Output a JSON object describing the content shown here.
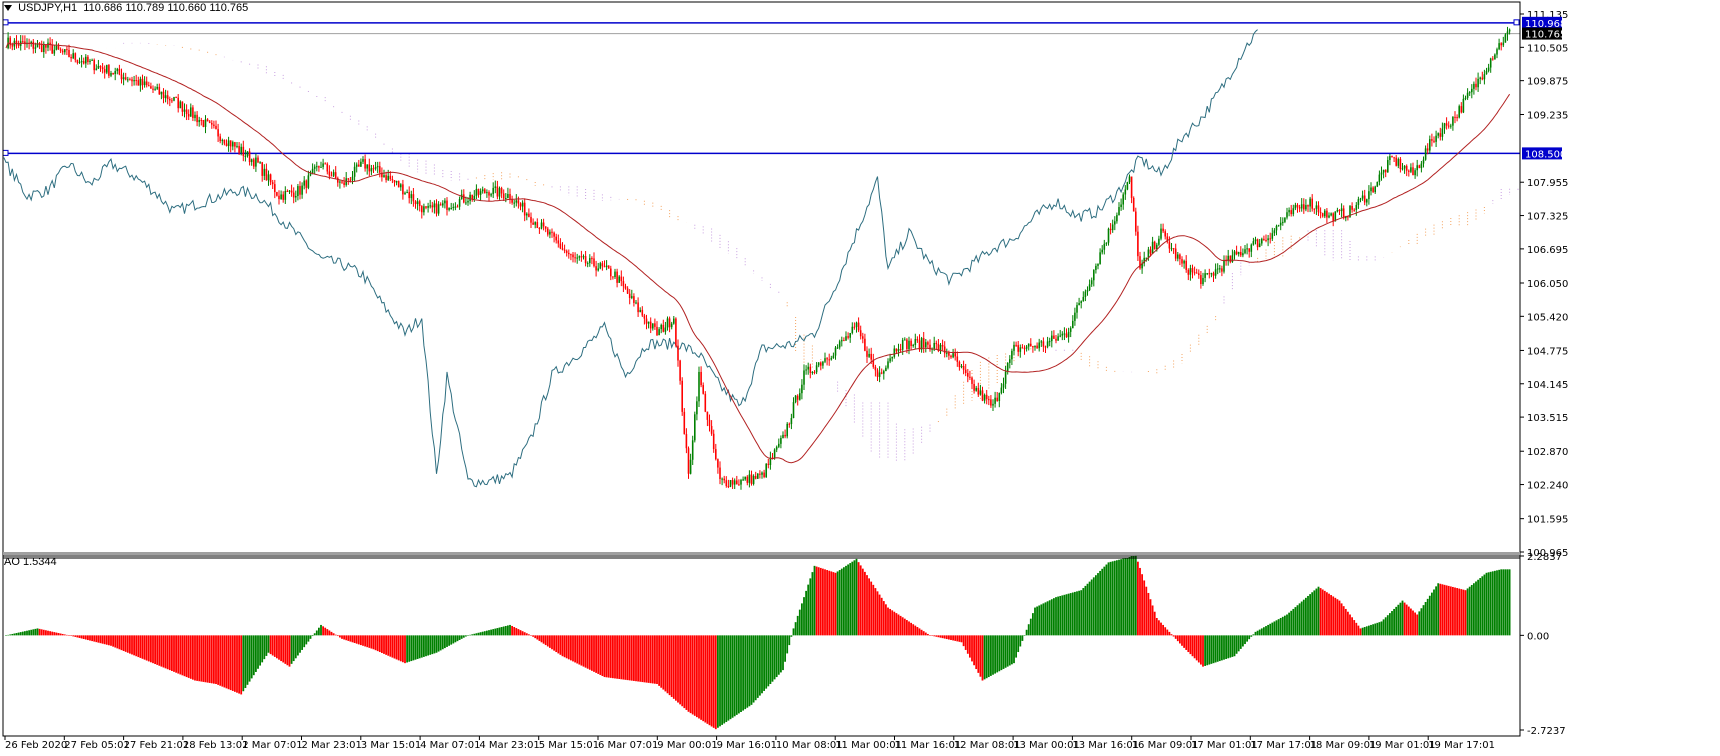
{
  "header": {
    "symbol": "USDJPY,H1",
    "open": "110.686",
    "high": "110.789",
    "low": "110.660",
    "close": "110.765"
  },
  "ao": {
    "label": "AO",
    "value": "1.5344"
  },
  "price_axis": {
    "ticks": [
      "111.135",
      "110.505",
      "109.875",
      "109.235",
      "107.955",
      "107.325",
      "106.695",
      "106.050",
      "105.420",
      "104.775",
      "104.145",
      "103.515",
      "102.870",
      "102.240",
      "101.595",
      "100.965"
    ],
    "tags": [
      {
        "label": "110.968",
        "color": "#0000cc",
        "text_color": "#ffffff"
      },
      {
        "label": "110.765",
        "color": "#000000",
        "text_color": "#ffffff"
      },
      {
        "label": "108.500",
        "color": "#0000cc",
        "text_color": "#ffffff"
      }
    ]
  },
  "ao_axis": {
    "ticks": [
      "2.2837",
      "0.00",
      "-2.7237"
    ]
  },
  "time_axis": {
    "labels": [
      "26 Feb 2020",
      "27 Feb 05:01",
      "27 Feb 21:01",
      "28 Feb 13:01",
      "2 Mar 07:01",
      "2 Mar 23:01",
      "3 Mar 15:01",
      "4 Mar 07:01",
      "4 Mar 23:01",
      "5 Mar 15:01",
      "6 Mar 07:01",
      "9 Mar 00:01",
      "9 Mar 16:01",
      "10 Mar 08:01",
      "11 Mar 00:01",
      "11 Mar 16:01",
      "12 Mar 08:01",
      "13 Mar 00:01",
      "13 Mar 16:01",
      "16 Mar 09:01",
      "17 Mar 01:01",
      "17 Mar 17:01",
      "18 Mar 09:01",
      "19 Mar 01:01",
      "19 Mar 17:01"
    ]
  },
  "colors": {
    "bull": "#008000",
    "bear": "#ff0000",
    "line_blue": "#0000cc",
    "chikou": "#2e6e80",
    "ma": "#b22222",
    "cloud_bull": "#f4a460",
    "cloud_bear": "#c8a0e0"
  },
  "chart_data": {
    "type": "candlestick",
    "symbol": "USDJPY",
    "timeframe": "H1",
    "ylim": [
      100.965,
      111.135
    ],
    "horizontal_levels": [
      110.968,
      108.5
    ],
    "current_price": 110.765,
    "close_path": [
      [
        0,
        110.6
      ],
      [
        20,
        110.5
      ],
      [
        40,
        110.2
      ],
      [
        60,
        109.9
      ],
      [
        80,
        109.5
      ],
      [
        100,
        108.9
      ],
      [
        120,
        108.3
      ],
      [
        130,
        107.7
      ],
      [
        140,
        107.8
      ],
      [
        150,
        108.3
      ],
      [
        160,
        107.9
      ],
      [
        170,
        108.3
      ],
      [
        180,
        108.1
      ],
      [
        190,
        107.8
      ],
      [
        200,
        107.4
      ],
      [
        215,
        107.6
      ],
      [
        230,
        107.8
      ],
      [
        240,
        107.7
      ],
      [
        255,
        107.1
      ],
      [
        270,
        106.5
      ],
      [
        280,
        106.4
      ],
      [
        290,
        106.2
      ],
      [
        300,
        105.6
      ],
      [
        310,
        105.1
      ],
      [
        318,
        105.4
      ],
      [
        325,
        102.4
      ],
      [
        330,
        104.3
      ],
      [
        340,
        102.3
      ],
      [
        350,
        102.3
      ],
      [
        360,
        102.4
      ],
      [
        370,
        103.1
      ],
      [
        380,
        104.3
      ],
      [
        395,
        104.8
      ],
      [
        405,
        105.2
      ],
      [
        415,
        104.3
      ],
      [
        425,
        104.9
      ],
      [
        440,
        104.9
      ],
      [
        450,
        104.7
      ],
      [
        460,
        104.1
      ],
      [
        470,
        103.7
      ],
      [
        480,
        104.8
      ],
      [
        495,
        104.9
      ],
      [
        505,
        105.1
      ],
      [
        515,
        106.0
      ],
      [
        525,
        107.0
      ],
      [
        535,
        108.0
      ],
      [
        540,
        106.3
      ],
      [
        550,
        107.0
      ],
      [
        560,
        106.4
      ],
      [
        570,
        106.1
      ],
      [
        580,
        106.4
      ],
      [
        590,
        106.7
      ],
      [
        600,
        106.9
      ],
      [
        610,
        107.3
      ],
      [
        620,
        107.6
      ],
      [
        630,
        107.3
      ],
      [
        640,
        107.4
      ],
      [
        650,
        107.8
      ],
      [
        660,
        108.4
      ],
      [
        670,
        108.1
      ],
      [
        680,
        108.8
      ],
      [
        690,
        109.2
      ],
      [
        700,
        109.8
      ],
      [
        710,
        110.5
      ],
      [
        716,
        110.8
      ]
    ],
    "ao_path": [
      [
        0,
        0.0
      ],
      [
        15,
        0.2
      ],
      [
        30,
        0.0
      ],
      [
        50,
        -0.3
      ],
      [
        70,
        -0.8
      ],
      [
        90,
        -1.3
      ],
      [
        100,
        -1.4
      ],
      [
        112,
        -1.7
      ],
      [
        125,
        -0.5
      ],
      [
        135,
        -0.9
      ],
      [
        150,
        0.3
      ],
      [
        160,
        -0.1
      ],
      [
        175,
        -0.4
      ],
      [
        190,
        -0.8
      ],
      [
        205,
        -0.5
      ],
      [
        220,
        0.0
      ],
      [
        240,
        0.3
      ],
      [
        250,
        0.0
      ],
      [
        265,
        -0.6
      ],
      [
        285,
        -1.2
      ],
      [
        310,
        -1.4
      ],
      [
        325,
        -2.2
      ],
      [
        338,
        -2.7
      ],
      [
        355,
        -2.0
      ],
      [
        370,
        -1.0
      ],
      [
        375,
        0.2
      ],
      [
        385,
        2.0
      ],
      [
        395,
        1.8
      ],
      [
        405,
        2.2
      ],
      [
        420,
        0.8
      ],
      [
        440,
        0.0
      ],
      [
        455,
        -0.2
      ],
      [
        465,
        -1.3
      ],
      [
        480,
        -0.8
      ],
      [
        490,
        0.8
      ],
      [
        500,
        1.1
      ],
      [
        512,
        1.3
      ],
      [
        525,
        2.1
      ],
      [
        538,
        2.3
      ],
      [
        548,
        0.5
      ],
      [
        560,
        -0.3
      ],
      [
        570,
        -0.9
      ],
      [
        585,
        -0.6
      ],
      [
        595,
        0.1
      ],
      [
        610,
        0.6
      ],
      [
        625,
        1.4
      ],
      [
        635,
        1.0
      ],
      [
        645,
        0.2
      ],
      [
        655,
        0.4
      ],
      [
        665,
        1.0
      ],
      [
        672,
        0.6
      ],
      [
        682,
        1.5
      ],
      [
        695,
        1.3
      ],
      [
        705,
        1.8
      ],
      [
        712,
        1.9
      ]
    ]
  }
}
